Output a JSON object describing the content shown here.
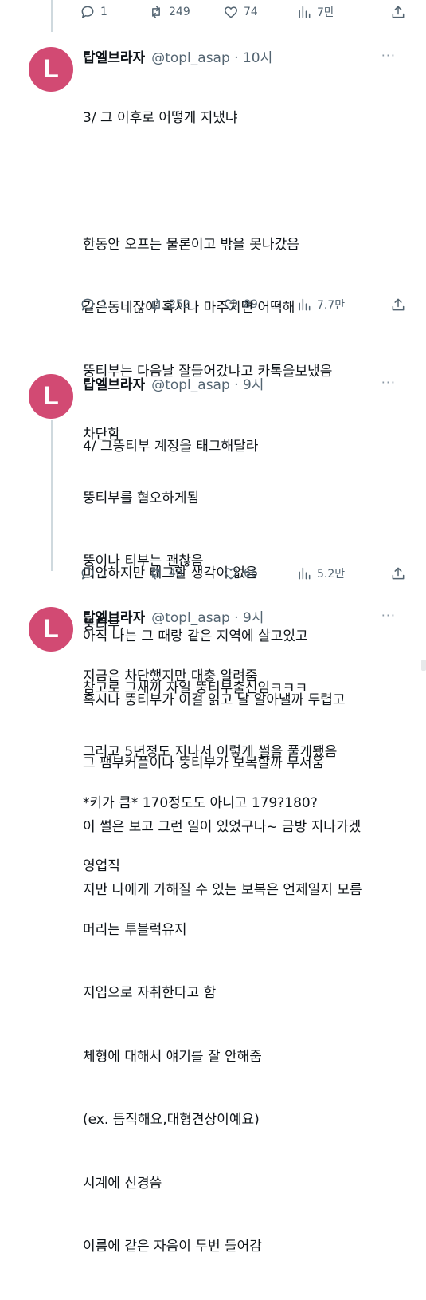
{
  "tweets": [
    {
      "actions": {
        "replies": "1",
        "retweets": "249",
        "likes": "74",
        "views": "7만"
      }
    },
    {
      "author": "탑엘브라자",
      "meta": "@topl_asap · 10시",
      "more": "···",
      "avatar_letter": "L",
      "lines": [
        "3/ 그 이후로 어떻게 지냈냐",
        "",
        "한동안 오프는 물론이고 밖을 못나갔음",
        "같은동네잖아 혹시나 마주치면 어떡해",
        "뚱티부는 다음날 잘들어갔냐고 카톡을보냈음",
        "차단함",
        "뚱티부를 혐오하게됨",
        "뚱이나 티부는 괜찮음",
        "뚱티부.",
        "참고로 그새끼 자일 뚱티부출신임ㅋㅋㅋ",
        "그러고 5년정도 지나서 이렇게 썰을 풀게됐음"
      ],
      "actions": {
        "replies": "1",
        "retweets": "252",
        "likes": "89",
        "views": "7.7만"
      }
    },
    {
      "author": "탑엘브라자",
      "meta": "@topl_asap · 9시",
      "more": "···",
      "avatar_letter": "L",
      "lines": [
        "4/ 그뚱티부 계정을 태그해달라",
        "",
        "미안하지만 태그할 생각이 없음",
        "아직 나는 그 때랑 같은 지역에 살고있고",
        "혹시나 뚱티부가 이걸 읽고 날 알아낼까 두렵고",
        "그 팸부커플이나 뚱티부가 보복할까 무서움",
        "이 썰은 보고 그런 일이 있었구나~ 금방 지나가겠",
        "지만 나에게 가해질 수 있는 보복은 언제일지 모름"
      ],
      "actions": {
        "replies": "1",
        "retweets": "46",
        "likes": "66",
        "views": "5.2만"
      }
    },
    {
      "author": "탑엘브라자",
      "meta": "@topl_asap · 9시",
      "more": "···",
      "avatar_letter": "L",
      "lines": [
        "지금은 차단했지만 대충 알려줌",
        "",
        "*키가 큼* 170정도도 아니고 179?180?",
        "영업직",
        "머리는 투블럭유지",
        "지입으로 자취한다고 함",
        "체형에 대해서 얘기를 잘 안해줌",
        "(ex. 듬직해요,대형견상이예요)",
        "시계에 신경씀",
        "이름에 같은 자음이 두번 들어감"
      ]
    }
  ]
}
